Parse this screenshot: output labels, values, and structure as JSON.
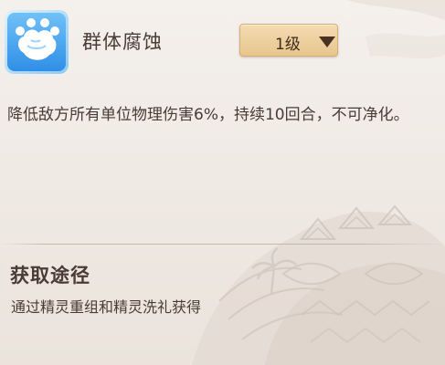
{
  "skill": {
    "icon": "paw-claw-icon",
    "name": "群体腐蚀",
    "level_label": "1级",
    "description": "降低敌方所有单位物理伤害6%，持续10回合，不可净化。"
  },
  "acquisition": {
    "title": "获取途径",
    "text": "通过精灵重组和精灵洗礼获得"
  },
  "colors": {
    "background": "#f1ece7",
    "text": "#4a3b34",
    "dropdown_fill": "#ecd0a0",
    "icon_blue": "#3fa2ee",
    "divider": "#beafa5"
  }
}
